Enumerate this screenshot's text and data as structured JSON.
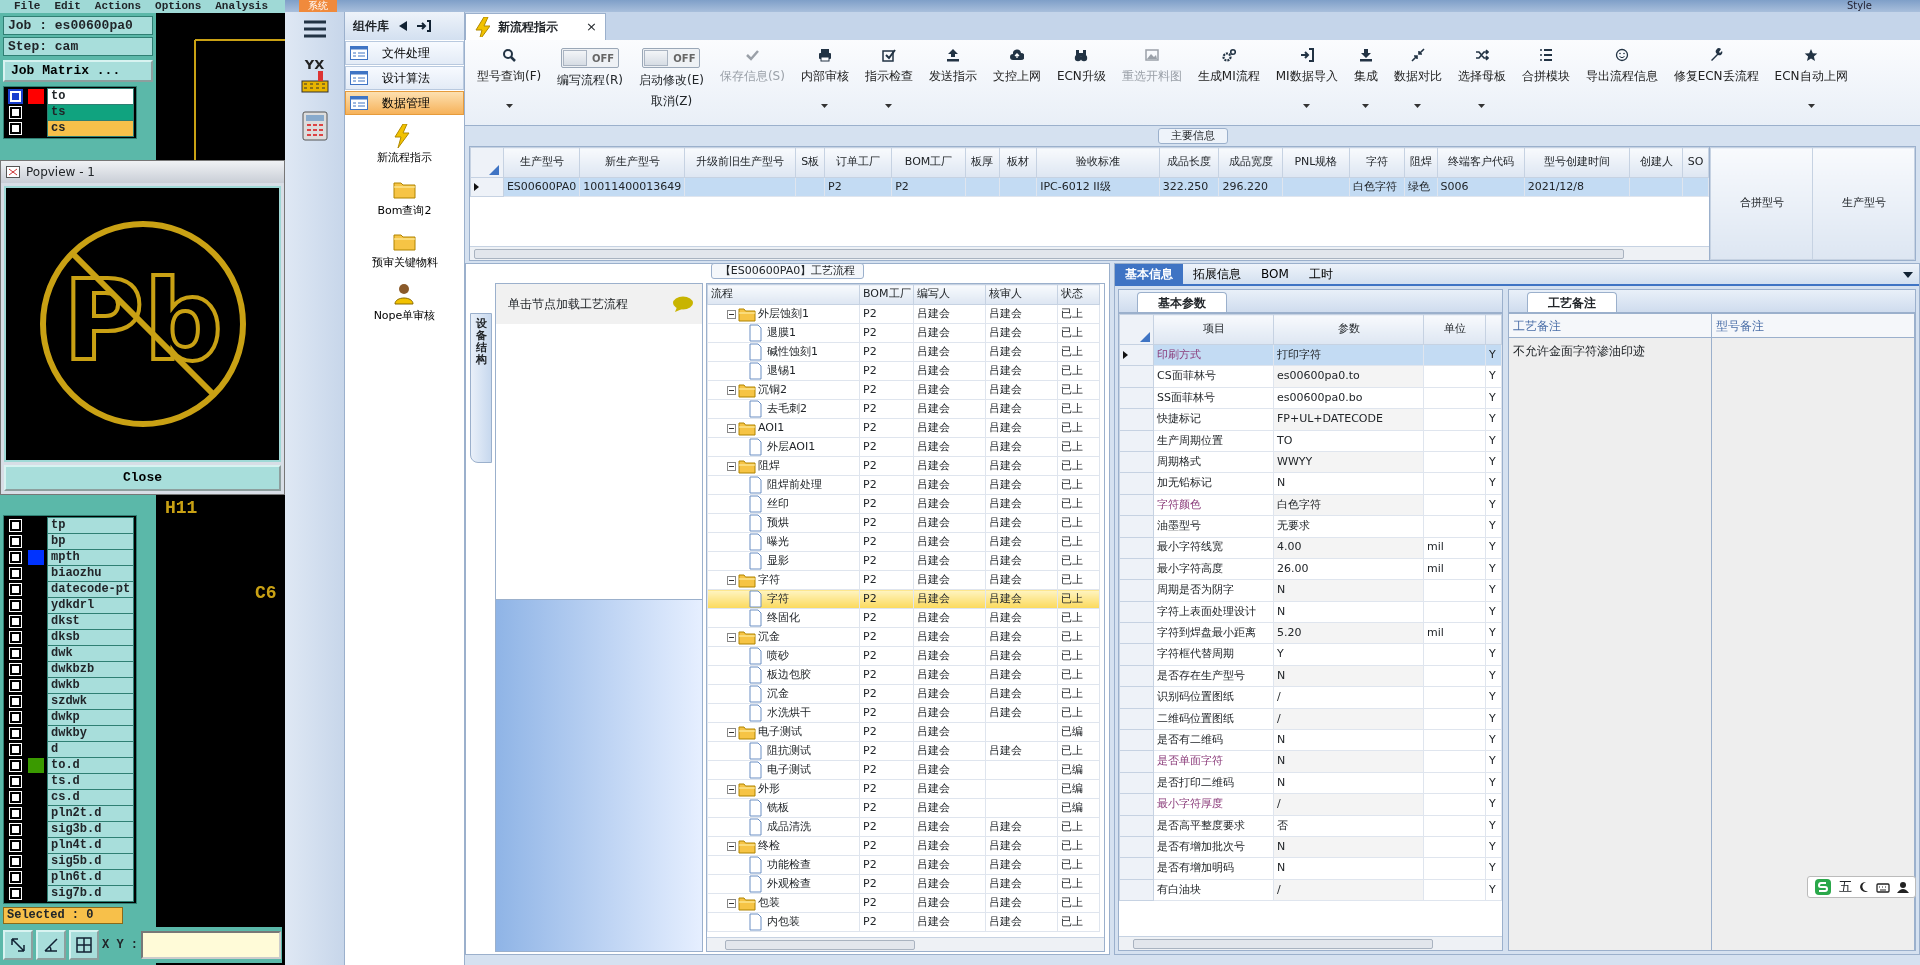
{
  "cam": {
    "menu": [
      "File",
      "Edit",
      "Actions",
      "Options",
      "Analysis"
    ],
    "job": "Job : es00600pa0",
    "step": "Step: cam",
    "job_matrix_button": "Job Matrix ...",
    "layers_above_popup": [
      {
        "name": "to",
        "active": true,
        "swatch": {
          "color": "#ff0000"
        },
        "color": "#ffffff"
      },
      {
        "name": "ts",
        "active": false,
        "color": "#10a37f"
      },
      {
        "name": "cs",
        "active": false,
        "color": "#f7c04a"
      }
    ],
    "layers_below_popup": [
      {
        "name": "tp",
        "active": false
      },
      {
        "name": "bp",
        "active": false
      },
      {
        "name": "mpth",
        "active": false,
        "swatch": {
          "color": "#0033ff"
        }
      },
      {
        "name": "biaozhu",
        "active": false
      },
      {
        "name": "datecode-pt",
        "active": false
      },
      {
        "name": "ydkdrl",
        "active": false
      },
      {
        "name": "dkst",
        "active": false
      },
      {
        "name": "dksb",
        "active": false
      },
      {
        "name": "dwk",
        "active": false
      },
      {
        "name": "dwkbzb",
        "active": false
      },
      {
        "name": "dwkb",
        "active": false
      },
      {
        "name": "szdwk",
        "active": false
      },
      {
        "name": "dwkp",
        "active": false
      },
      {
        "name": "dwkby",
        "active": false
      },
      {
        "name": "d",
        "active": false
      },
      {
        "name": "to.d",
        "active": false,
        "swatch": {
          "color": "#3a9a00"
        }
      },
      {
        "name": "ts.d",
        "active": false
      },
      {
        "name": "cs.d",
        "active": false
      },
      {
        "name": "pln2t.d",
        "active": false
      },
      {
        "name": "sig3b.d",
        "active": false
      },
      {
        "name": "pln4t.d",
        "active": false
      },
      {
        "name": "sig5b.d",
        "active": false
      },
      {
        "name": "pln6t.d",
        "active": false
      },
      {
        "name": "sig7b.d",
        "active": false
      }
    ],
    "selected_count": "Selected : 0",
    "xy_label": "X Y :",
    "canvas_texts": [
      "H11",
      "C6"
    ],
    "popup": {
      "title": "Popview - 1",
      "symbol_text": "Pb",
      "close_button": "Close"
    }
  },
  "title_bar": {
    "menu_tab": "系统",
    "style_menu": "Style"
  },
  "nav_logo_text": "YX",
  "component_library": {
    "title": "组件库",
    "categories": [
      {
        "label": "文件处理",
        "selected": false
      },
      {
        "label": "设计算法",
        "selected": false
      },
      {
        "label": "数据管理",
        "selected": true
      }
    ],
    "tools": [
      "新流程指示",
      "Bom查询2",
      "预审关键物料",
      "Nope单审核"
    ]
  },
  "document_tab": {
    "title": "新流程指示",
    "close": "×"
  },
  "toolbar": [
    {
      "kind": "button",
      "label": "型号查询(F)",
      "dropdown": true,
      "disabled": false
    },
    {
      "kind": "toggle",
      "label": "编写流程(R)",
      "switch_text": "OFF",
      "on": false
    },
    {
      "kind": "toggle",
      "label": "启动修改(E)",
      "sublabel": "取消(Z)",
      "switch_text": "OFF",
      "on": false
    },
    {
      "kind": "button",
      "label": "保存信息(S)",
      "dropdown": false,
      "disabled": true
    },
    {
      "kind": "button",
      "label": "内部审核",
      "dropdown": true,
      "disabled": false
    },
    {
      "kind": "button",
      "label": "指示检查",
      "dropdown": true,
      "disabled": false
    },
    {
      "kind": "button",
      "label": "发送指示",
      "dropdown": false,
      "disabled": false
    },
    {
      "kind": "button",
      "label": "文控上网",
      "dropdown": false,
      "disabled": false
    },
    {
      "kind": "button",
      "label": "ECN升级",
      "dropdown": false,
      "disabled": false
    },
    {
      "kind": "button",
      "label": "重选开料图",
      "dropdown": false,
      "disabled": true
    },
    {
      "kind": "button",
      "label": "生成MI流程",
      "dropdown": false,
      "disabled": false
    },
    {
      "kind": "button",
      "label": "MI数据导入",
      "dropdown": true,
      "disabled": false
    },
    {
      "kind": "button",
      "label": "集成",
      "dropdown": true,
      "disabled": false
    },
    {
      "kind": "button",
      "label": "数据对比",
      "dropdown": true,
      "disabled": false
    },
    {
      "kind": "button",
      "label": "选择母板",
      "dropdown": true,
      "disabled": false
    },
    {
      "kind": "button",
      "label": "合拼模块",
      "dropdown": false,
      "disabled": false
    },
    {
      "kind": "button",
      "label": "导出流程信息",
      "dropdown": false,
      "disabled": false
    },
    {
      "kind": "button",
      "label": "修复ECN丢流程",
      "dropdown": false,
      "disabled": false
    },
    {
      "kind": "button",
      "label": "ECN自动上网",
      "dropdown": true,
      "disabled": false
    }
  ],
  "main_info": {
    "title": "主要信息",
    "columns": [
      "生产型号",
      "新生产型号",
      "升级前旧生产型号",
      "S板",
      "订单工厂",
      "BOM工厂",
      "板厚",
      "板材",
      "验收标准",
      "成品长度",
      "成品宽度",
      "PNL规格",
      "字符",
      "阻焊",
      "终端客户代码",
      "型号创建时间",
      "创建人",
      "SO"
    ],
    "rows": [
      {
        "selected": true,
        "cells": [
          "ES00600PA0",
          "10011400013649",
          null,
          null,
          "P2",
          "P2",
          null,
          null,
          "IPC-6012 II级",
          "322.250",
          "296.220",
          null,
          "白色字符",
          "绿色",
          "S006",
          "2021/12/8",
          null,
          null
        ]
      }
    ],
    "side_columns": [
      "合拼型号",
      "生产型号"
    ]
  },
  "process_panel": {
    "title": "【ES00600PA0】工艺流程",
    "side_tab": "设备结构",
    "hint": "单击节点加载工艺流程",
    "columns": [
      "流程",
      "BOM工厂",
      "编写人",
      "核审人",
      "状态"
    ],
    "tree": [
      {
        "label": "外层蚀刻1",
        "bom": "P2",
        "writer": "吕建会",
        "reviewer": "吕建会",
        "status": "已上",
        "expanded": true,
        "selected": false,
        "children": [
          {
            "label": "退膜1",
            "bom": "P2",
            "writer": "吕建会",
            "reviewer": "吕建会",
            "status": "已上",
            "selected": false
          },
          {
            "label": "碱性蚀刻1",
            "bom": "P2",
            "writer": "吕建会",
            "reviewer": "吕建会",
            "status": "已上",
            "selected": false
          },
          {
            "label": "退锡1",
            "bom": "P2",
            "writer": "吕建会",
            "reviewer": "吕建会",
            "status": "已上",
            "selected": false
          }
        ]
      },
      {
        "label": "沉铜2",
        "bom": "P2",
        "writer": "吕建会",
        "reviewer": "吕建会",
        "status": "已上",
        "expanded": true,
        "selected": false,
        "children": [
          {
            "label": "去毛刺2",
            "bom": "P2",
            "writer": "吕建会",
            "reviewer": "吕建会",
            "status": "已上",
            "selected": false
          }
        ]
      },
      {
        "label": "AOI1",
        "bom": "P2",
        "writer": "吕建会",
        "reviewer": "吕建会",
        "status": "已上",
        "expanded": true,
        "selected": false,
        "children": [
          {
            "label": "外层AOI1",
            "bom": "P2",
            "writer": "吕建会",
            "reviewer": "吕建会",
            "status": "已上",
            "selected": false
          }
        ]
      },
      {
        "label": "阻焊",
        "bom": "P2",
        "writer": "吕建会",
        "reviewer": "吕建会",
        "status": "已上",
        "expanded": true,
        "selected": false,
        "children": [
          {
            "label": "阻焊前处理",
            "bom": "P2",
            "writer": "吕建会",
            "reviewer": "吕建会",
            "status": "已上",
            "selected": false
          },
          {
            "label": "丝印",
            "bom": "P2",
            "writer": "吕建会",
            "reviewer": "吕建会",
            "status": "已上",
            "selected": false
          },
          {
            "label": "预烘",
            "bom": "P2",
            "writer": "吕建会",
            "reviewer": "吕建会",
            "status": "已上",
            "selected": false
          },
          {
            "label": "曝光",
            "bom": "P2",
            "writer": "吕建会",
            "reviewer": "吕建会",
            "status": "已上",
            "selected": false
          },
          {
            "label": "显影",
            "bom": "P2",
            "writer": "吕建会",
            "reviewer": "吕建会",
            "status": "已上",
            "selected": false
          }
        ]
      },
      {
        "label": "字符",
        "bom": "P2",
        "writer": "吕建会",
        "reviewer": "吕建会",
        "status": "已上",
        "expanded": true,
        "selected": false,
        "children": [
          {
            "label": "字符",
            "bom": "P2",
            "writer": "吕建会",
            "reviewer": "吕建会",
            "status": "已上",
            "selected": true
          },
          {
            "label": "终固化",
            "bom": "P2",
            "writer": "吕建会",
            "reviewer": "吕建会",
            "status": "已上",
            "selected": false
          }
        ]
      },
      {
        "label": "沉金",
        "bom": "P2",
        "writer": "吕建会",
        "reviewer": "吕建会",
        "status": "已上",
        "expanded": true,
        "selected": false,
        "children": [
          {
            "label": "喷砂",
            "bom": "P2",
            "writer": "吕建会",
            "reviewer": "吕建会",
            "status": "已上",
            "selected": false
          },
          {
            "label": "板边包胶",
            "bom": "P2",
            "writer": "吕建会",
            "reviewer": "吕建会",
            "status": "已上",
            "selected": false
          },
          {
            "label": "沉金",
            "bom": "P2",
            "writer": "吕建会",
            "reviewer": "吕建会",
            "status": "已上",
            "selected": false
          },
          {
            "label": "水洗烘干",
            "bom": "P2",
            "writer": "吕建会",
            "reviewer": "吕建会",
            "status": "已上",
            "selected": false
          }
        ]
      },
      {
        "label": "电子测试",
        "bom": "P2",
        "writer": "吕建会",
        "status": "已编",
        "expanded": true,
        "selected": false,
        "children": [
          {
            "label": "阻抗测试",
            "bom": "P2",
            "writer": "吕建会",
            "reviewer": "吕建会",
            "status": "已上",
            "selected": false
          },
          {
            "label": "电子测试",
            "bom": "P2",
            "writer": "吕建会",
            "status": "已编",
            "selected": false
          }
        ]
      },
      {
        "label": "外形",
        "bom": "P2",
        "writer": "吕建会",
        "status": "已编",
        "expanded": true,
        "selected": false,
        "children": [
          {
            "label": "铣板",
            "bom": "P2",
            "writer": "吕建会",
            "status": "已编",
            "selected": false
          },
          {
            "label": "成品清洗",
            "bom": "P2",
            "writer": "吕建会",
            "reviewer": "吕建会",
            "status": "已上",
            "selected": false
          }
        ]
      },
      {
        "label": "终检",
        "bom": "P2",
        "writer": "吕建会",
        "reviewer": "吕建会",
        "status": "已上",
        "expanded": true,
        "selected": false,
        "children": [
          {
            "label": "功能检查",
            "bom": "P2",
            "writer": "吕建会",
            "reviewer": "吕建会",
            "status": "已上",
            "selected": false
          },
          {
            "label": "外观检查",
            "bom": "P2",
            "writer": "吕建会",
            "reviewer": "吕建会",
            "status": "已上",
            "selected": false
          }
        ]
      },
      {
        "label": "包装",
        "bom": "P2",
        "writer": "吕建会",
        "reviewer": "吕建会",
        "status": "已上",
        "expanded": true,
        "selected": false,
        "children": [
          {
            "label": "内包装",
            "bom": "P2",
            "writer": "吕建会",
            "reviewer": "吕建会",
            "status": "已上",
            "selected": false
          }
        ]
      }
    ]
  },
  "detail_panel": {
    "tabs": [
      {
        "label": "基本信息",
        "selected": true
      },
      {
        "label": "拓展信息",
        "selected": false
      },
      {
        "label": "BOM",
        "selected": false
      },
      {
        "label": "工时",
        "selected": false
      }
    ],
    "params": {
      "tab": "基本参数",
      "columns": [
        "项目",
        "参数",
        "单位"
      ],
      "rows": [
        {
          "item": "印刷方式",
          "value": "打印字符",
          "flag": "Y",
          "highlighted": true,
          "selected": true
        },
        {
          "item": "CS面菲林号",
          "value": "es00600pa0.to",
          "flag": "Y",
          "highlighted": false,
          "selected": false
        },
        {
          "item": "SS面菲林号",
          "value": "es00600pa0.bo",
          "flag": "Y",
          "highlighted": false,
          "selected": false
        },
        {
          "item": "快捷标记",
          "value": "FP+UL+DATECODE",
          "flag": "Y",
          "highlighted": false,
          "selected": false
        },
        {
          "item": "生产周期位置",
          "value": "TO",
          "flag": "Y",
          "highlighted": false,
          "selected": false
        },
        {
          "item": "周期格式",
          "value": "WWYY",
          "flag": "Y",
          "highlighted": false,
          "selected": false
        },
        {
          "item": "加无铅标记",
          "value": "N",
          "flag": "Y",
          "highlighted": false,
          "selected": false
        },
        {
          "item": "字符颜色",
          "value": "白色字符",
          "flag": "Y",
          "highlighted": true,
          "selected": false
        },
        {
          "item": "油墨型号",
          "value": "无要求",
          "flag": "Y",
          "highlighted": false,
          "selected": false
        },
        {
          "item": "最小字符线宽",
          "value": "4.00",
          "unit": "mil",
          "flag": "Y",
          "highlighted": false,
          "selected": false
        },
        {
          "item": "最小字符高度",
          "value": "26.00",
          "unit": "mil",
          "flag": "Y",
          "highlighted": false,
          "selected": false
        },
        {
          "item": "周期是否为阴字",
          "value": "N",
          "flag": "Y",
          "highlighted": false,
          "selected": false
        },
        {
          "item": "字符上表面处理设计",
          "value": "N",
          "flag": "Y",
          "highlighted": false,
          "selected": false
        },
        {
          "item": "字符到焊盘最小距离",
          "value": "5.20",
          "unit": "mil",
          "flag": "Y",
          "highlighted": false,
          "selected": false
        },
        {
          "item": "字符框代替周期",
          "value": "Y",
          "flag": "Y",
          "highlighted": false,
          "selected": false
        },
        {
          "item": "是否存在生产型号",
          "value": "N",
          "flag": "Y",
          "highlighted": false,
          "selected": false
        },
        {
          "item": "识别码位置图纸",
          "value": "/",
          "flag": "Y",
          "highlighted": false,
          "selected": false
        },
        {
          "item": "二维码位置图纸",
          "value": "/",
          "flag": "Y",
          "highlighted": false,
          "selected": false
        },
        {
          "item": "是否有二维码",
          "value": "N",
          "flag": "Y",
          "highlighted": false,
          "selected": false
        },
        {
          "item": "是否单面字符",
          "value": "N",
          "flag": "Y",
          "highlighted": true,
          "selected": false
        },
        {
          "item": "是否打印二维码",
          "value": "N",
          "flag": "Y",
          "highlighted": false,
          "selected": false
        },
        {
          "item": "最小字符厚度",
          "value": "/",
          "flag": "Y",
          "highlighted": true,
          "selected": false
        },
        {
          "item": "是否高平整度要求",
          "value": "否",
          "flag": "Y",
          "highlighted": false,
          "selected": false
        },
        {
          "item": "是否有增加批次号",
          "value": "N",
          "flag": "Y",
          "highlighted": false,
          "selected": false
        },
        {
          "item": "是否有增加明码",
          "value": "N",
          "flag": "Y",
          "highlighted": false,
          "selected": false
        },
        {
          "item": "有白油块",
          "value": "/",
          "flag": "Y",
          "highlighted": false,
          "selected": false
        }
      ]
    },
    "notes": {
      "tab": "工艺备注",
      "columns": [
        "工艺备注",
        "型号备注"
      ],
      "process_note": "不允许金面字符渗油印迹"
    }
  },
  "ime_toolbar": {
    "mode": "五"
  }
}
